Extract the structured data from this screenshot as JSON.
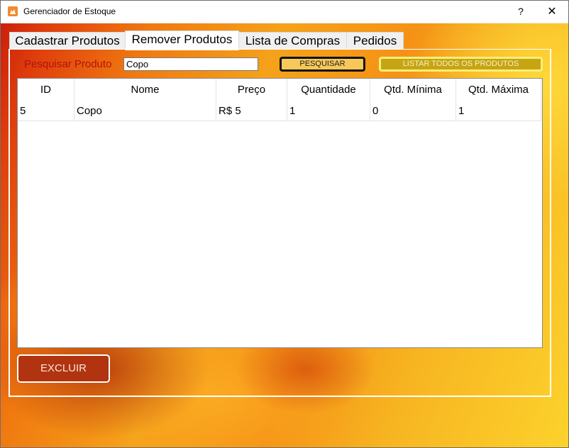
{
  "window": {
    "title": "Gerenciador de Estoque",
    "help_label": "?",
    "close_label": "✕"
  },
  "tabs": [
    {
      "label": "Cadastrar Produtos",
      "active": false
    },
    {
      "label": "Remover Produtos",
      "active": true
    },
    {
      "label": "Lista de Compras",
      "active": false
    },
    {
      "label": "Pedidos",
      "active": false
    }
  ],
  "search": {
    "label": "Pesquisar Produto",
    "value": "Copo",
    "search_button": "PESQUISAR",
    "list_all_button": "LISTAR TODOS OS PRODUTOS"
  },
  "table": {
    "columns": [
      "ID",
      "Nome",
      "Preço",
      "Quantidade",
      "Qtd. Mínima",
      "Qtd. Máxima"
    ],
    "rows": [
      [
        "5",
        "Copo",
        "R$ 5",
        "1",
        "0",
        "1"
      ]
    ]
  },
  "actions": {
    "delete_button": "EXCLUIR"
  },
  "colors": {
    "label_red": "#b3120c",
    "search_button_bg": "#f6c85a",
    "list_button_bg": "#c7a512",
    "delete_button_bg": "#b2330f"
  }
}
